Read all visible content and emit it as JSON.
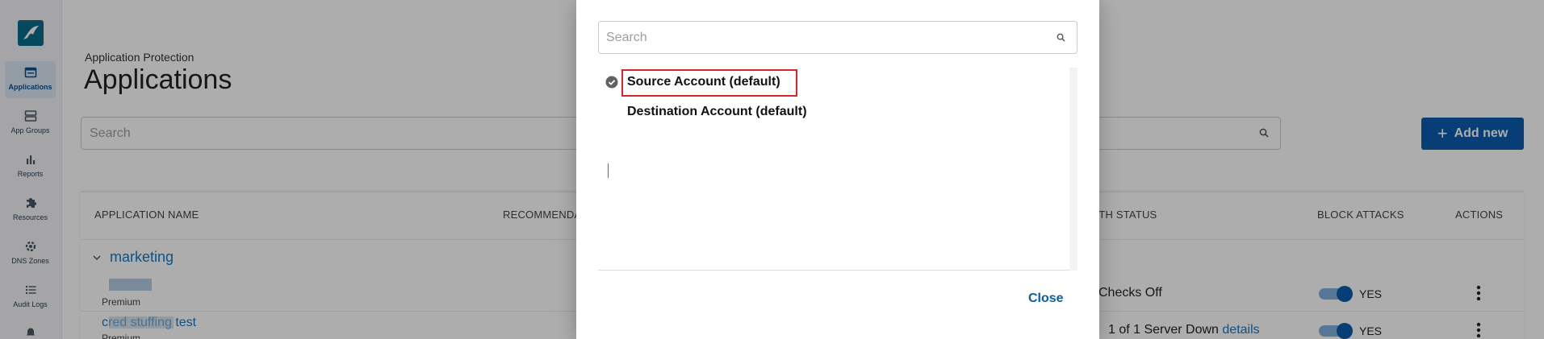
{
  "sidebar": {
    "items": [
      {
        "label": "Applications",
        "icon": "applications-icon",
        "active": true
      },
      {
        "label": "App Groups",
        "icon": "app-groups-icon"
      },
      {
        "label": "Reports",
        "icon": "reports-icon"
      },
      {
        "label": "Resources",
        "icon": "resources-icon"
      },
      {
        "label": "DNS Zones",
        "icon": "dns-zones-icon"
      },
      {
        "label": "Audit Logs",
        "icon": "audit-logs-icon"
      }
    ]
  },
  "page": {
    "breadcrumb": "Application Protection",
    "title": "Applications",
    "search_placeholder": "Search",
    "add_button": "Add new"
  },
  "table": {
    "columns": [
      "APPLICATION NAME",
      "RECOMMENDA",
      "ALTH STATUS",
      "BLOCK ATTACKS",
      "ACTIONS"
    ],
    "group": {
      "name": "marketing"
    },
    "rows": [
      {
        "name": "",
        "plan": "Premium",
        "health": "Checks Off",
        "health_link": "",
        "block": "YES"
      },
      {
        "name": "cred stuffing test",
        "plan": "Premium",
        "health": "1 of 1 Server Down",
        "health_link": "details",
        "block": "YES"
      }
    ]
  },
  "modal": {
    "search_placeholder": "Search",
    "accounts": [
      {
        "label": "Source Account (default)",
        "selected": true,
        "highlighted": true
      },
      {
        "label": "Destination Account (default)",
        "selected": false
      }
    ],
    "close_label": "Close"
  },
  "colors": {
    "accent": "#0b5cad",
    "link": "#1679c6",
    "highlight": "#d8262c"
  }
}
